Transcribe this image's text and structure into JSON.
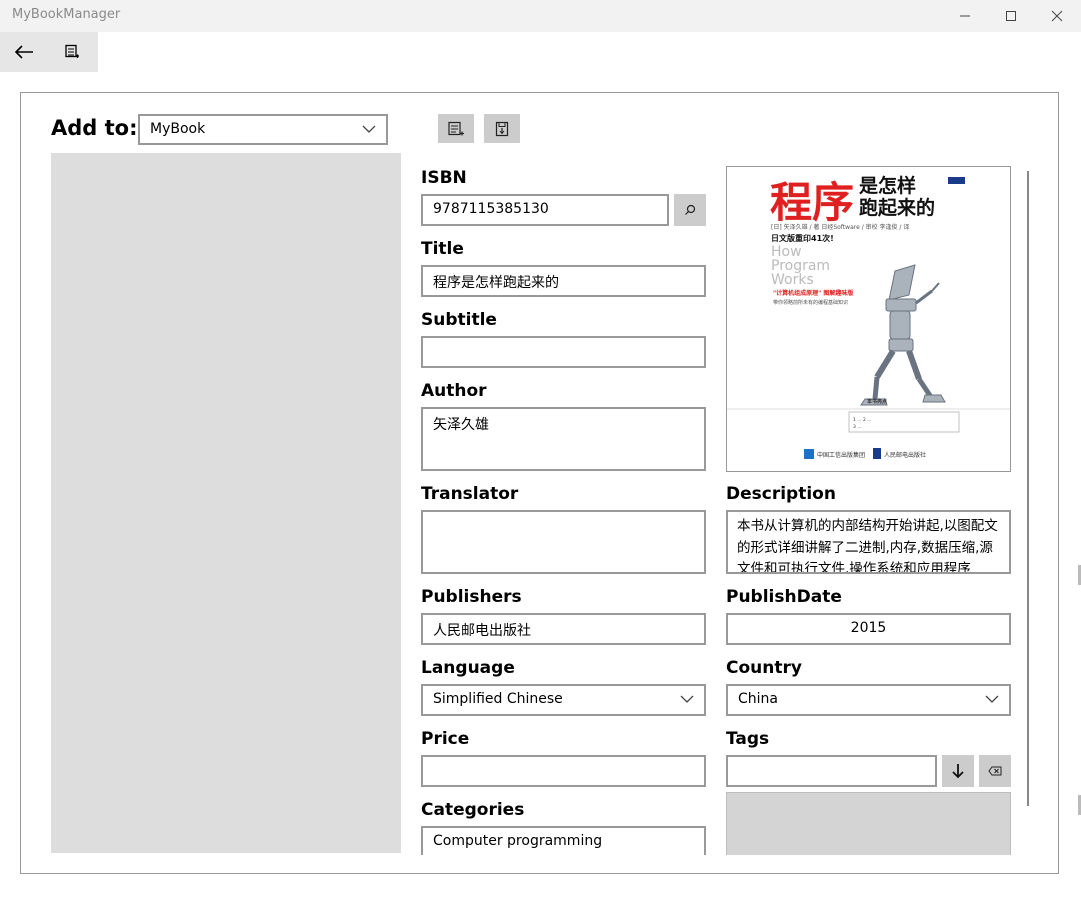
{
  "window": {
    "title": "MyBookManager"
  },
  "add_to": {
    "label": "Add to:",
    "selected": "MyBook"
  },
  "fields": {
    "isbn": {
      "label": "ISBN",
      "value": "9787115385130"
    },
    "title": {
      "label": "Title",
      "value": "程序是怎样跑起来的"
    },
    "subtitle": {
      "label": "Subtitle",
      "value": ""
    },
    "author": {
      "label": "Author",
      "value": "矢泽久雄"
    },
    "translator": {
      "label": "Translator",
      "value": ""
    },
    "publishers": {
      "label": "Publishers",
      "value": "人民邮电出版社"
    },
    "language": {
      "label": "Language",
      "value": "Simplified Chinese"
    },
    "price": {
      "label": "Price",
      "value": ""
    },
    "categories": {
      "label": "Categories",
      "value": "Computer programming"
    },
    "description": {
      "label": "Description",
      "value": "本书从计算机的内部结构开始讲起,以图配文的形式详细讲解了二进制,内存,数据压缩,源文件和可执行文件,操作系统和应用程序"
    },
    "publish_date": {
      "label": "PublishDate",
      "value": "2015"
    },
    "country": {
      "label": "Country",
      "value": "China"
    },
    "tags": {
      "label": "Tags",
      "value": ""
    }
  },
  "cover": {
    "title_big": "程序",
    "title_rest_1": "是怎样",
    "title_rest_2": "跑起来的",
    "authors_line": "[日] 矢泽久雄 / 著  日经Software / 审校  李逢俊 / 译",
    "reprint": "日文版重印41次!",
    "en_line_1": "How",
    "en_line_2": "Program",
    "en_line_3": "Works",
    "slogan": "\"计算机组成原理\" 图解趣味版",
    "sub_slogan": "带你领略前所未有的编程基础知识",
    "publisher_1": "中国工信出版集团",
    "publisher_2": "人民邮电出版社"
  },
  "colors": {
    "accent_red": "#e02020",
    "panel_gray": "#dddddd",
    "button_gray": "#cccccc"
  },
  "icons": [
    "back-arrow-icon",
    "book-list-icon",
    "new-book-icon",
    "save-icon",
    "search-icon",
    "chevron-down-icon",
    "down-arrow-icon",
    "backspace-icon",
    "minimize-icon",
    "maximize-icon",
    "close-icon"
  ]
}
